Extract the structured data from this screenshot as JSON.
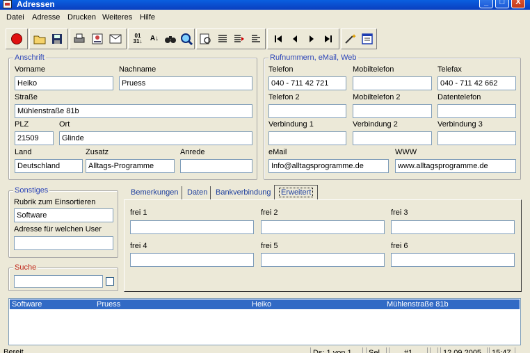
{
  "window": {
    "title": "Adressen",
    "controls": [
      "_",
      "□",
      "X"
    ]
  },
  "menu": [
    "Datei",
    "Adresse",
    "Drucken",
    "Weiteres",
    "Hilfe"
  ],
  "anschrift": {
    "legend": "Anschrift",
    "vorname_label": "Vorname",
    "vorname": "Heiko",
    "nachname_label": "Nachname",
    "nachname": "Pruess",
    "strasse_label": "Straße",
    "strasse": "Mühlenstraße 81b",
    "plz_label": "PLZ",
    "plz": "21509",
    "ort_label": "Ort",
    "ort": "Glinde",
    "land_label": "Land",
    "land": "Deutschland",
    "zusatz_label": "Zusatz",
    "zusatz": "Alltags-Programme",
    "anrede_label": "Anrede",
    "anrede": ""
  },
  "kontakt": {
    "legend": "Rufnummern, eMail, Web",
    "telefon_label": "Telefon",
    "telefon": "040 - 711 42 721",
    "mobil_label": "Mobiltelefon",
    "mobil": "",
    "telefax_label": "Telefax",
    "telefax": "040 - 711 42 662",
    "telefon2_label": "Telefon 2",
    "telefon2": "",
    "mobil2_label": "Mobiltelefon 2",
    "mobil2": "",
    "datentelefon_label": "Datentelefon",
    "datentelefon": "",
    "verb1_label": "Verbindung 1",
    "verb1": "",
    "verb2_label": "Verbindung 2",
    "verb2": "",
    "verb3_label": "Verbindung 3",
    "verb3": "",
    "email_label": "eMail",
    "email": "Info@alltagsprogramme.de",
    "www_label": "WWW",
    "www": "www.alltagsprogramme.de"
  },
  "sonstiges": {
    "legend": "Sonstiges",
    "rubrik_label": "Rubrik zum Einsortieren",
    "rubrik": "Software",
    "user_label": "Adresse für welchen User",
    "user": ""
  },
  "suche": {
    "legend": "Suche",
    "value": ""
  },
  "tabs": [
    "Bemerkungen",
    "Daten",
    "Bankverbindung",
    "Erweitert"
  ],
  "erweitert": {
    "frei1_label": "frei 1",
    "frei2_label": "frei 2",
    "frei3_label": "frei 3",
    "frei4_label": "frei 4",
    "frei5_label": "frei 5",
    "frei6_label": "frei 6"
  },
  "list": {
    "rows": [
      {
        "rubrik": "Software",
        "name": "Pruess",
        "vorname": "Heiko",
        "strasse": "Mühlenstraße 81b"
      }
    ]
  },
  "status": {
    "text": "Bereit",
    "record": "Ds: 1 von 1",
    "sel": "Sel",
    "num": "#1",
    "date": "12.09.2005",
    "time": "15:47"
  },
  "colors": {
    "titlebar": "#0a4fd0",
    "accent_label": "#2b44b8",
    "suche_label": "#c0281c",
    "selection": "#316ac5"
  }
}
